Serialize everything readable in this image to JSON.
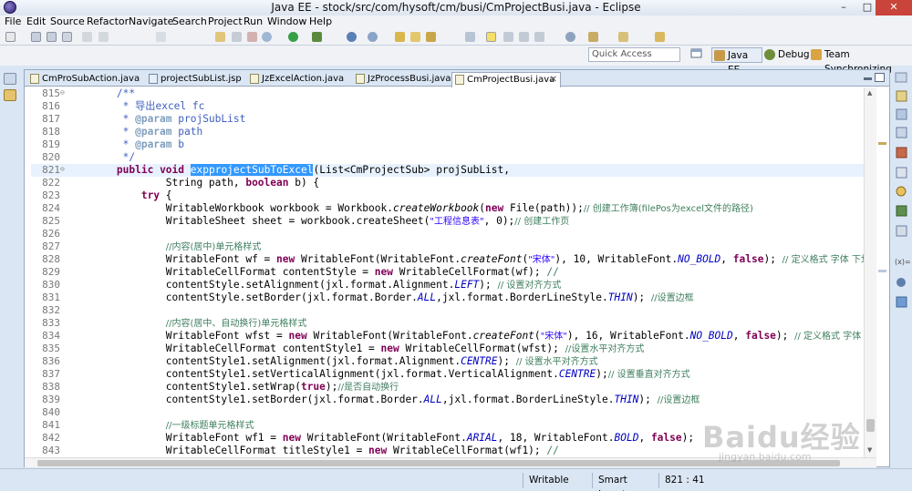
{
  "window": {
    "title": "Java EE - stock/src/com/hysoft/cm/busi/CmProjectBusi.java - Eclipse",
    "min_glyph": "–",
    "max_glyph": "□",
    "close_glyph": "✕"
  },
  "menu": [
    "File",
    "Edit",
    "Source",
    "Refactor",
    "Navigate",
    "Search",
    "Project",
    "Run",
    "Window",
    "Help"
  ],
  "toolbar": {
    "icons": [
      "new-icon",
      "save-icon",
      "save-all-icon",
      "print-icon",
      "cut-icon",
      "undo-icon",
      "redo-icon",
      "suspend-icon",
      "resume-icon",
      "terminate-icon",
      "disconnect-icon",
      "step-into-icon",
      "step-over-icon",
      "debug-icon",
      "run-icon",
      "coverage-icon",
      "external-tools-icon",
      "new-server-icon",
      "new-class-icon",
      "open-type-icon",
      "open-folder-icon",
      "search-icon",
      "highlight-icon",
      "annotation-icon",
      "toggle-block-icon",
      "show-whitespace-icon",
      "pin-icon",
      "back-icon",
      "forward-icon",
      "last-edit-icon"
    ]
  },
  "quick_access": {
    "placeholder": "Quick Access"
  },
  "perspectives": [
    {
      "label": "Java EE",
      "active": true
    },
    {
      "label": "Debug",
      "active": false
    },
    {
      "label": "Team Synchronizing",
      "active": false
    }
  ],
  "tabs": [
    {
      "label": "CmProSubAction.java",
      "active": false
    },
    {
      "label": "projectSubList.jsp",
      "active": false
    },
    {
      "label": "JzExcelAction.java",
      "active": false
    },
    {
      "label": "JzProcessBusi.java",
      "active": false
    },
    {
      "label": "CmProjectBusi.java",
      "active": true,
      "close": "✕"
    }
  ],
  "code_lines": [
    {
      "num": "815",
      "fold": "⊖"
    },
    {
      "num": "816"
    },
    {
      "num": "817"
    },
    {
      "num": "818"
    },
    {
      "num": "819"
    },
    {
      "num": "820"
    },
    {
      "num": "821",
      "fold": "⊖",
      "current": true
    },
    {
      "num": "822"
    },
    {
      "num": "823"
    },
    {
      "num": "824"
    },
    {
      "num": "825"
    },
    {
      "num": "826"
    },
    {
      "num": "827"
    },
    {
      "num": "828"
    },
    {
      "num": "829"
    },
    {
      "num": "830"
    },
    {
      "num": "831"
    },
    {
      "num": "832"
    },
    {
      "num": "833"
    },
    {
      "num": "834"
    },
    {
      "num": "835"
    },
    {
      "num": "836"
    },
    {
      "num": "837"
    },
    {
      "num": "838"
    },
    {
      "num": "839"
    },
    {
      "num": "840"
    },
    {
      "num": "841"
    },
    {
      "num": "842"
    },
    {
      "num": "843"
    }
  ],
  "code": {
    "l815": "        /**",
    "l816a": "         * ",
    "l816b": "导出excel fc",
    "l817a": "         * ",
    "l817b": "@param",
    "l817c": " projSubList",
    "l818a": "         * ",
    "l818b": "@param",
    "l818c": " path",
    "l819a": "         * ",
    "l819b": "@param",
    "l819c": " b",
    "l820": "         */",
    "l821a": "        ",
    "l821b": "public",
    "l821c": " ",
    "l821d": "void",
    "l821e": " ",
    "l821f": "expprojectSubToExcel",
    "l821g": "(List<CmProjectSub> projSubList,",
    "l822a": "                String path, ",
    "l822b": "boolean",
    "l822c": " b) {",
    "l823a": "            ",
    "l823b": "try",
    "l823c": " {",
    "l824a": "                WritableWorkbook workbook = Workbook.",
    "l824b": "createWorkbook",
    "l824c": "(",
    "l824d": "new",
    "l824e": " File(path));",
    "l824f": "// 创建工作簿(filePos为excel文件的路径)",
    "l825a": "                WritableSheet sheet = workbook.createSheet(",
    "l825b": "\"工程信息表\"",
    "l825c": ", 0);",
    "l825d": "// 创建工作页",
    "l827a": "                ",
    "l827b": "//内容(居中)单元格样式",
    "l828a": "                WritableFont wf = ",
    "l828b": "new",
    "l828c": " WritableFont(WritableFont.",
    "l828d": "createFont",
    "l828e": "(",
    "l828f": "\"宋体\"",
    "l828g": "), 10, WritableFont.",
    "l828h": "NO_BOLD",
    "l828i": ", ",
    "l828j": "false",
    "l828k": "); ",
    "l828l": "// 定义格式 字体 下划线",
    "l829a": "                WritableCellFormat contentStyle = ",
    "l829b": "new",
    "l829c": " WritableCellFormat(wf); ",
    "l829d": "//",
    "l830a": "                contentStyle.setAlignment(jxl.format.Alignment.",
    "l830b": "LEFT",
    "l830c": "); ",
    "l830d": "// 设置对齐方式",
    "l831a": "                contentStyle.setBorder(jxl.format.Border.",
    "l831b": "ALL",
    "l831c": ",jxl.format.BorderLineStyle.",
    "l831d": "THIN",
    "l831e": "); ",
    "l831f": "//设置边框",
    "l833a": "                ",
    "l833b": "//内容(居中、自动换行)单元格样式",
    "l834a": "                WritableFont wfst = ",
    "l834b": "new",
    "l834c": " WritableFont(WritableFont.",
    "l834d": "createFont",
    "l834e": "(",
    "l834f": "\"宋体\"",
    "l834g": "), 16, WritableFont.",
    "l834h": "NO_BOLD",
    "l834i": ", ",
    "l834j": "false",
    "l834k": "); ",
    "l834l": "// 定义格式 字体 下划",
    "l835a": "                WritableCellFormat contentStyle1 = ",
    "l835b": "new",
    "l835c": " WritableCellFormat(wfst); ",
    "l835d": "//设置水平对齐方式",
    "l836a": "                contentStyle1.setAlignment(jxl.format.Alignment.",
    "l836b": "CENTRE",
    "l836c": "); ",
    "l836d": "// 设置水平对齐方式",
    "l837a": "                contentStyle1.setVerticalAlignment(jxl.format.VerticalAlignment.",
    "l837b": "CENTRE",
    "l837c": ");",
    "l837d": "// 设置垂直对齐方式",
    "l838a": "                contentStyle1.setWrap(",
    "l838b": "true",
    "l838c": ");",
    "l838d": "//是否自动换行",
    "l839a": "                contentStyle1.setBorder(jxl.format.Border.",
    "l839b": "ALL",
    "l839c": ",jxl.format.BorderLineStyle.",
    "l839d": "THIN",
    "l839e": "); ",
    "l839f": "//设置边框",
    "l841a": "                ",
    "l841b": "//一级标题单元格样式",
    "l842a": "                WritableFont wf1 = ",
    "l842b": "new",
    "l842c": " WritableFont(WritableFont.",
    "l842d": "ARIAL",
    "l842e": ", 18, WritableFont.",
    "l842f": "BOLD",
    "l842g": ", ",
    "l842h": "false",
    "l842i": ");",
    "l843a": "                WritableCellFormat titleStyle1 = ",
    "l843b": "new",
    "l843c": " WritableCellFormat(wf1); ",
    "l843d": "//"
  },
  "status": {
    "mode": "Writable",
    "insert": "Smart Insert",
    "position": "821 : 41"
  },
  "watermark": {
    "main": "Baidu经验",
    "sub": "jingyan.baidu.com"
  },
  "colors": {
    "keyword": "#7f0055",
    "comment": "#3f7f5f",
    "javadoc": "#3f5fbf",
    "string": "#2a00ff",
    "static_field": "#0000c0",
    "selection": "#3399ff",
    "current_line": "#e8f2fe"
  }
}
